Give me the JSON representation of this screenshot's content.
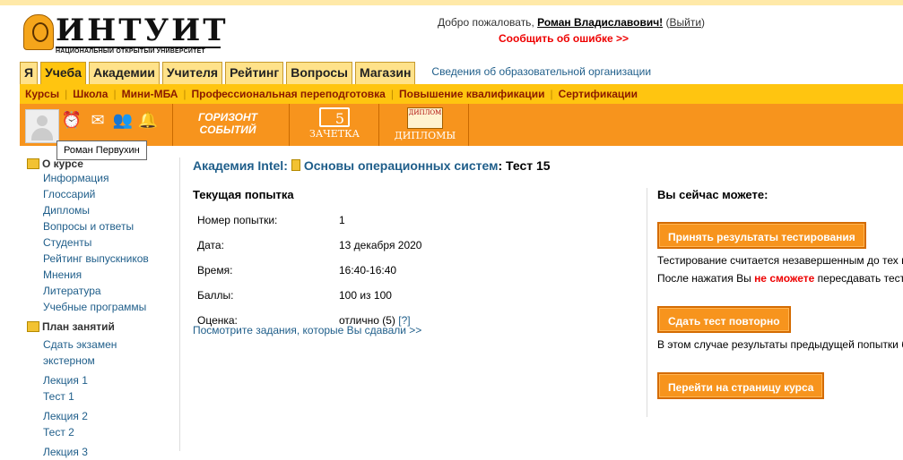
{
  "header": {
    "logo_name": "ИНТУИТ",
    "logo_sub": "НАЦИОНАЛЬНЫЙ ОТКРЫТЫЙ УНИВЕРСИТЕТ",
    "welcome_prefix": "Добро пожаловать,",
    "user_name": "Роман Владиславович!",
    "exit_open": "(",
    "exit_label": "Выйти",
    "exit_close": ")",
    "report_error": "Сообщить об ошибке >>"
  },
  "main_tabs": [
    {
      "label": "Я"
    },
    {
      "label": "Учеба"
    },
    {
      "label": "Академии"
    },
    {
      "label": "Учителя"
    },
    {
      "label": "Рейтинг"
    },
    {
      "label": "Вопросы"
    },
    {
      "label": "Магазин"
    }
  ],
  "org_link": "Сведения об образовательной организации",
  "subnav": [
    {
      "label": "Курсы"
    },
    {
      "label": "Школа"
    },
    {
      "label": "Мини-МБА"
    },
    {
      "label": "Профессиональная переподготовка"
    },
    {
      "label": "Повышение квалификации"
    },
    {
      "label": "Сертификации"
    }
  ],
  "toolbar": {
    "horizon_line1": "ГОРИЗОНТ",
    "horizon_line2": "СОБЫТИЙ",
    "zachetka_num": "5",
    "zachetka": "ЗАЧЕТКА",
    "diplomy_doc": "ДИПЛОМ",
    "diplomy": "ДИПЛОМЫ",
    "tooltip": "Роман Первухин"
  },
  "sidebar": {
    "about": "О курсе",
    "links": [
      "Информация",
      "Глоссарий",
      "Дипломы",
      "Вопросы и ответы",
      "Студенты",
      "Рейтинг выпускников",
      "Мнения",
      "Литература",
      "Учебные программы"
    ],
    "plan": "План занятий",
    "plan_items": [
      {
        "line1": "Сдать экзамен",
        "line2": "экстерном",
        "link": true
      },
      {
        "line1": "Лекция 1",
        "line2": "Тест 1",
        "link": false
      },
      {
        "line1": "Лекция 2",
        "line2": "Тест 2",
        "link": false
      },
      {
        "line1": "Лекция 3",
        "line2": "",
        "link": false
      }
    ]
  },
  "breadcrumb": {
    "academy": "Академия Intel:",
    "course": "Основы операционных систем",
    "colon": ":",
    "test": "Тест 15"
  },
  "current_attempt": {
    "title": "Текущая попытка",
    "rows": [
      {
        "k": "Номер попытки:",
        "v": "1"
      },
      {
        "k": "Дата:",
        "v": "13 декабря 2020"
      },
      {
        "k": "Время:",
        "v": "16:40-16:40"
      },
      {
        "k": "Баллы:",
        "v": "100 из 100"
      },
      {
        "k": "Оценка:",
        "v": "отлично (5)"
      }
    ],
    "help": "[?]",
    "review_link": "Посмотрите задания, которые Вы сдавали >>"
  },
  "actions": {
    "title": "Вы сейчас можете:",
    "accept": "Принять результаты тестирования",
    "note1": "Тестирование считается незавершенным до тех п",
    "note2_prefix": "После нажатия Вы",
    "note2_strong": "не сможете",
    "note2_suffix": "пересдавать тест",
    "retake": "Сдать тест повторно",
    "note3": "В этом случае результаты предыдущей попытки б",
    "goto": "Перейти на страницу курса"
  },
  "colors": {
    "accent_orange": "#f7941d",
    "tab_yellow": "#ffc510",
    "link_blue": "#1f5e8a",
    "alert_red": "#e00000"
  }
}
